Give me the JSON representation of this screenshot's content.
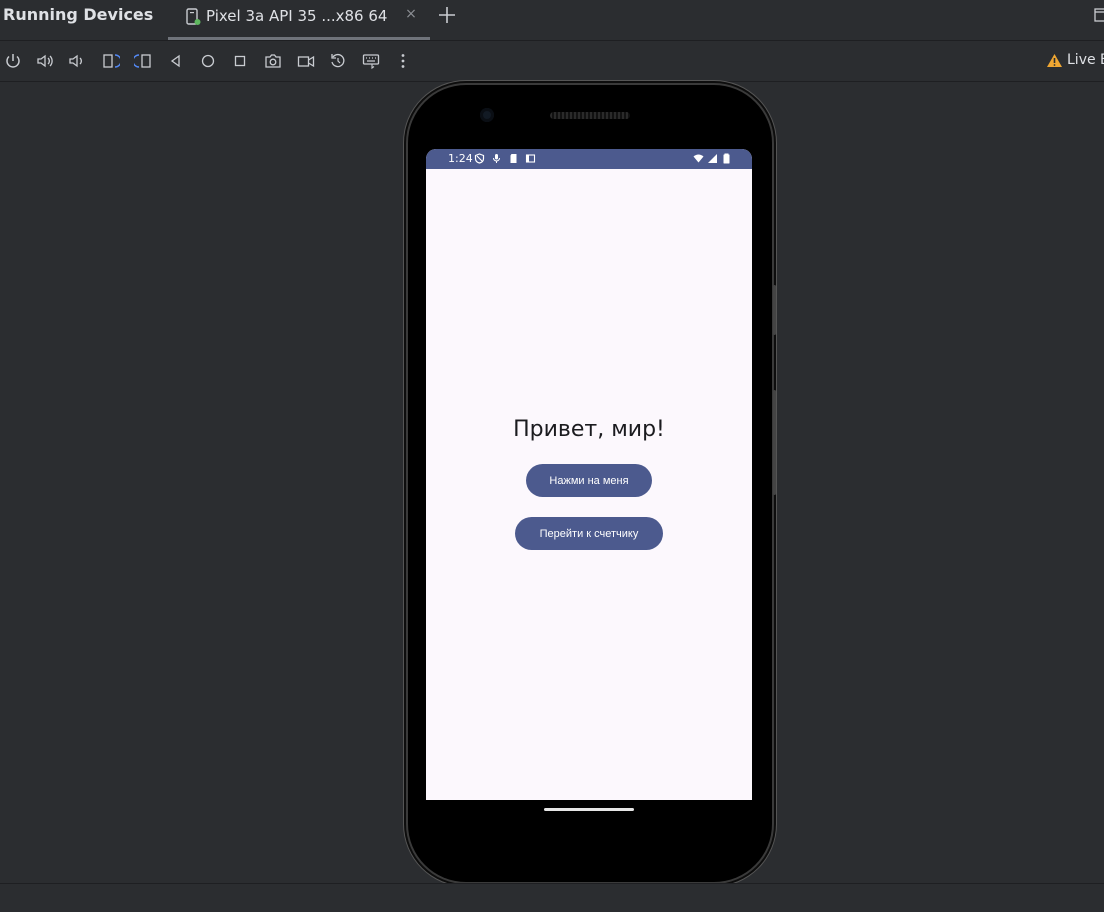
{
  "tool_window": {
    "title": "Running Devices"
  },
  "tabs": [
    {
      "label": "Pixel 3a API 35 ...x86 64",
      "close": "×"
    }
  ],
  "toolbar": {
    "icons": [
      "power-icon",
      "volume-up-icon",
      "volume-down-icon",
      "rotate-left-icon",
      "rotate-right-icon",
      "back-icon",
      "home-icon",
      "overview-icon",
      "screenshot-icon",
      "screen-record-icon",
      "reset-icon",
      "keyboard-icon",
      "more-icon"
    ],
    "live_edit_label": "Live E"
  },
  "colors": {
    "ide_bg": "#2b2d30",
    "accent": "#4c5a8e",
    "screen_bg": "#fcf8fd",
    "warning": "#f0a732"
  },
  "device": {
    "status_bar": {
      "time": "1:24"
    },
    "app": {
      "greeting": "Привет, мир!",
      "button_primary": "Нажми на меня",
      "button_counter": "Перейти к счетчику"
    }
  }
}
